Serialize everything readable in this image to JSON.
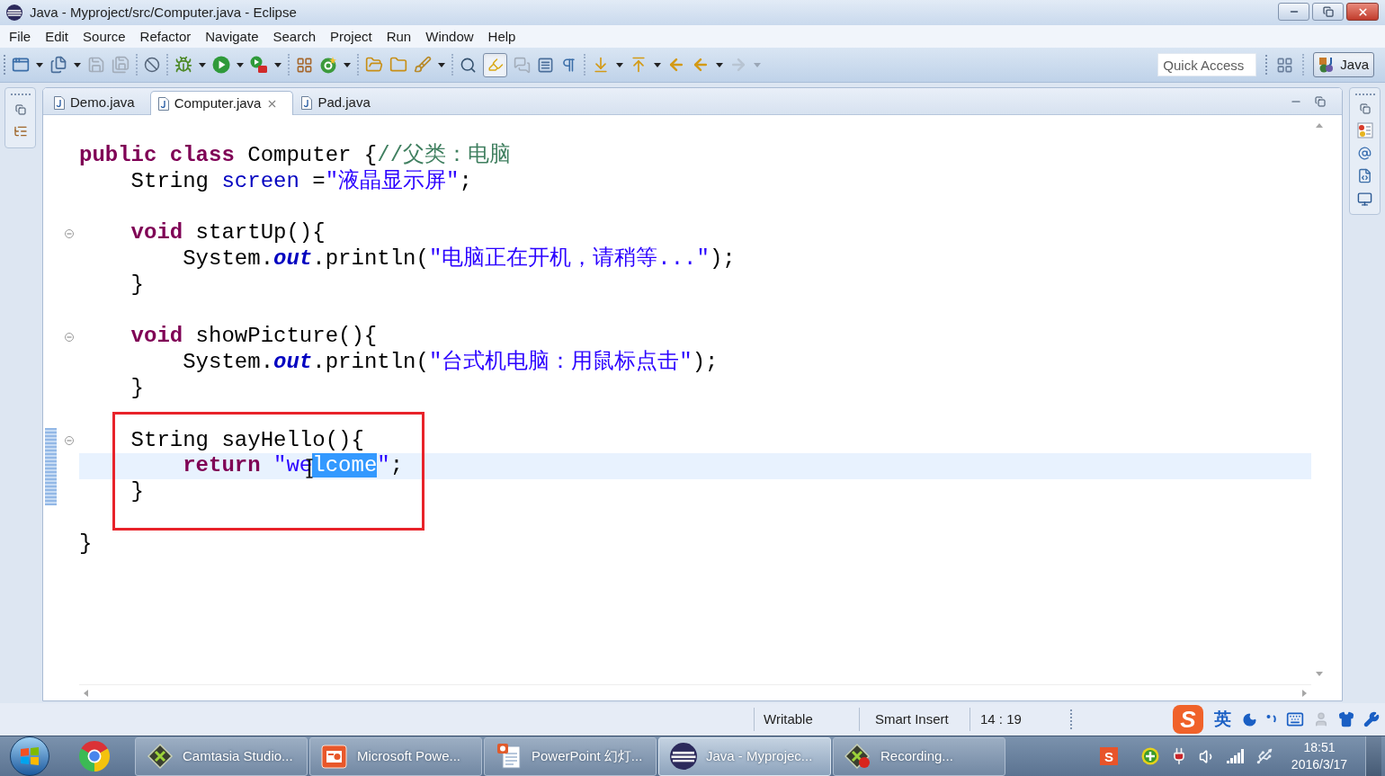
{
  "window": {
    "title": "Java - Myproject/src/Computer.java - Eclipse"
  },
  "menu": [
    "File",
    "Edit",
    "Source",
    "Refactor",
    "Navigate",
    "Search",
    "Project",
    "Run",
    "Window",
    "Help"
  ],
  "toolbar": {
    "toggle": {
      "pressed": true
    },
    "quick_access": {
      "placeholder": "Quick Access"
    },
    "perspective": {
      "label": "Java",
      "selected": true
    }
  },
  "editor": {
    "tabs": [
      {
        "label": "Demo.java",
        "selected": false
      },
      {
        "label": "Computer.java",
        "selected": true
      },
      {
        "label": "Pad.java",
        "selected": false
      }
    ],
    "blocks": [
      {
        "changed": false,
        "boxed": false,
        "lines": [
          {
            "tokens": [
              {
                "kind": "keyword",
                "text": "public class"
              },
              {
                "kind": "plain",
                "text": " Computer {"
              },
              {
                "kind": "comment",
                "text": "//父类：电脑"
              }
            ],
            "fold": false,
            "current": false
          },
          {
            "tokens": [
              {
                "kind": "plain",
                "text": "    String "
              },
              {
                "kind": "field",
                "text": "screen"
              },
              {
                "kind": "plain",
                "text": " ="
              },
              {
                "kind": "string",
                "text": "\"液晶显示屏\""
              },
              {
                "kind": "plain",
                "text": ";"
              }
            ],
            "fold": false,
            "current": false
          }
        ]
      },
      {
        "changed": false,
        "boxed": false,
        "lines": [
          {
            "tokens": [
              {
                "kind": "keyword",
                "text": "    void"
              },
              {
                "kind": "plain",
                "text": " startUp(){"
              }
            ],
            "fold": true,
            "current": false
          },
          {
            "tokens": [
              {
                "kind": "plain",
                "text": "        System."
              },
              {
                "kind": "static",
                "text": "out"
              },
              {
                "kind": "plain",
                "text": ".println("
              },
              {
                "kind": "string",
                "text": "\"电脑正在开机，请稍等...\""
              },
              {
                "kind": "plain",
                "text": ");"
              }
            ],
            "fold": false,
            "current": false
          },
          {
            "tokens": [
              {
                "kind": "plain",
                "text": "    }"
              }
            ],
            "fold": false,
            "current": false
          }
        ]
      },
      {
        "changed": false,
        "boxed": false,
        "lines": [
          {
            "tokens": [
              {
                "kind": "keyword",
                "text": "    void"
              },
              {
                "kind": "plain",
                "text": " showPicture(){"
              }
            ],
            "fold": true,
            "current": false
          },
          {
            "tokens": [
              {
                "kind": "plain",
                "text": "        System."
              },
              {
                "kind": "static",
                "text": "out"
              },
              {
                "kind": "plain",
                "text": ".println("
              },
              {
                "kind": "string",
                "text": "\"台式机电脑：用鼠标点击\""
              },
              {
                "kind": "plain",
                "text": ");"
              }
            ],
            "fold": false,
            "current": false
          },
          {
            "tokens": [
              {
                "kind": "plain",
                "text": "    }"
              }
            ],
            "fold": false,
            "current": false
          }
        ]
      },
      {
        "changed": true,
        "boxed": true,
        "lines": [
          {
            "tokens": [
              {
                "kind": "plain",
                "text": "    String sayHello(){"
              }
            ],
            "fold": true,
            "current": false
          },
          {
            "tokens": [
              {
                "kind": "keyword",
                "text": "        return "
              },
              {
                "kind": "string",
                "text": "\"we"
              },
              {
                "kind": "selection",
                "text": "lcome"
              },
              {
                "kind": "string",
                "text": "\""
              },
              {
                "kind": "plain",
                "text": ";"
              }
            ],
            "fold": false,
            "current": true
          },
          {
            "tokens": [
              {
                "kind": "plain",
                "text": "    }"
              }
            ],
            "fold": false,
            "current": false
          }
        ]
      },
      {
        "changed": false,
        "boxed": false,
        "lines": [
          {
            "tokens": [
              {
                "kind": "plain",
                "text": "}"
              }
            ],
            "fold": false,
            "current": false
          }
        ]
      }
    ]
  },
  "status_bar": {
    "fields": [
      "Writable",
      "Smart Insert",
      "14 : 19"
    ]
  },
  "ime_bar": {
    "logo": "S",
    "mode": "英"
  },
  "taskbar": {
    "buttons": [
      {
        "label": "Camtasia Studio...",
        "selected": false
      },
      {
        "label": "Microsoft Powe...",
        "selected": false
      },
      {
        "label": "PowerPoint 幻灯...",
        "selected": false
      },
      {
        "label": "Java - Myprojec...",
        "selected": true
      },
      {
        "label": "Recording...",
        "selected": false
      }
    ],
    "tray": {
      "ime_logo": "S"
    },
    "clock": {
      "time": "18:51",
      "date": "2016/3/17"
    }
  }
}
